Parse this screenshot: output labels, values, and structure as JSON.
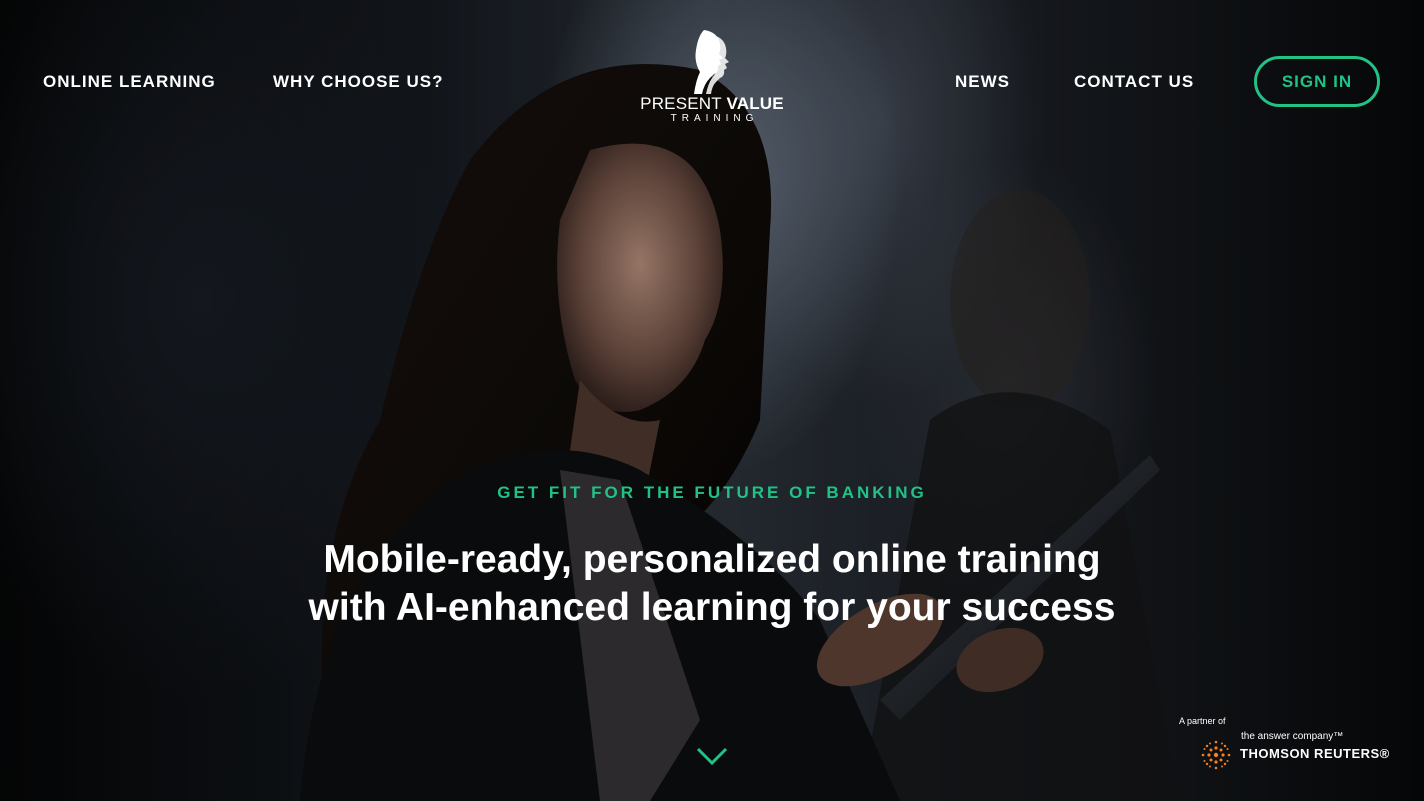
{
  "nav": {
    "left": [
      {
        "label": "ONLINE LEARNING"
      },
      {
        "label": "WHY CHOOSE US?"
      }
    ],
    "right": [
      {
        "label": "NEWS"
      },
      {
        "label": "CONTACT US"
      }
    ],
    "signin_label": "SIGN IN"
  },
  "logo": {
    "name_regular": "PRESENT ",
    "name_bold": "VALUE",
    "subtitle": "TRAINING"
  },
  "hero": {
    "eyebrow": "GET FIT FOR THE FUTURE OF BANKING",
    "headline_line1": "Mobile-ready, personalized online training",
    "headline_line2": "with AI-enhanced learning for your success",
    "scroll_icon": "chevron-down-icon"
  },
  "partner": {
    "prefix": "A partner of",
    "tagline": "the answer company™",
    "name": "THOMSON REUTERS®",
    "icon": "thomson-reuters-logo"
  },
  "colors": {
    "accent": "#21c285",
    "text": "#ffffff",
    "partner_orange": "#f57f20"
  }
}
